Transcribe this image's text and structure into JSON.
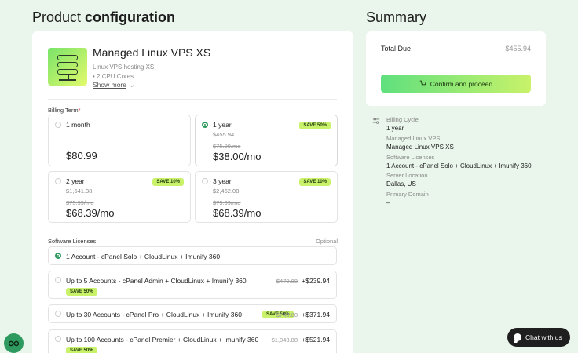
{
  "header": {
    "title_part1": "Product ",
    "title_part2": "configuration",
    "summary_title": "Summary"
  },
  "product": {
    "name": "Managed Linux VPS XS",
    "desc_line1": "Linux VPS hosting XS:",
    "desc_line2": "• 2 CPU Cores...",
    "show_more": "Show more",
    "icon": "server-stack-icon"
  },
  "billing": {
    "label": "Billing Term",
    "required_mark": "*",
    "options": [
      {
        "name": "1 month",
        "price": "$80.99",
        "selected": false
      },
      {
        "name": "1 year",
        "sub": "$455.94",
        "strike": "$75.99/mo",
        "price": "$38.00/mo",
        "badge": "SAVE 50%",
        "selected": true
      },
      {
        "name": "2 year",
        "sub": "$1,641.38",
        "strike": "$75.99/mo",
        "price": "$68.39/mo",
        "badge": "SAVE 10%",
        "selected": false
      },
      {
        "name": "3 year",
        "sub": "$2,462.08",
        "strike": "$75.99/mo",
        "price": "$68.39/mo",
        "badge": "SAVE 10%",
        "selected": false
      }
    ]
  },
  "licenses": {
    "label": "Software Licenses",
    "optional": "Optional",
    "items": [
      {
        "name": "1 Account - cPanel Solo + CloudLinux + Imunify 360",
        "selected": true
      },
      {
        "name": "Up to 5 Accounts - cPanel Admin + CloudLinux + Imunify 360",
        "strike": "$479.88",
        "price": "+$239.94",
        "badge": "SAVE 50%"
      },
      {
        "name": "Up to 30 Accounts - cPanel Pro + CloudLinux + Imunify 360",
        "strike": "$743.88",
        "price": "+$371.94",
        "badge": "SAVE 50%"
      },
      {
        "name": "Up to 100 Accounts - cPanel Premier + CloudLinux + Imunify 360",
        "strike": "$1,043.88",
        "price": "+$521.94",
        "badge": "SAVE 50%"
      }
    ]
  },
  "summary": {
    "total_label": "Total Due",
    "total_value": "$455.94",
    "confirm_label": "Confirm and proceed",
    "details": [
      {
        "key": "Billing Cycle",
        "value": "1 year"
      },
      {
        "key": "Managed Linux VPS",
        "value": "Managed Linux VPS XS"
      },
      {
        "key": "Software Licenses",
        "value": "1 Account - cPanel Solo + CloudLinux + Imunify 360"
      },
      {
        "key": "Server Location",
        "value": "Dallas, US"
      },
      {
        "key": "Primary Domain",
        "value": "–"
      }
    ]
  },
  "chat": {
    "label": "Chat with us"
  },
  "colors": {
    "accent_green": "#2f9a5f",
    "badge_lime": "#c9f26a",
    "background": "#eaf6ec"
  }
}
